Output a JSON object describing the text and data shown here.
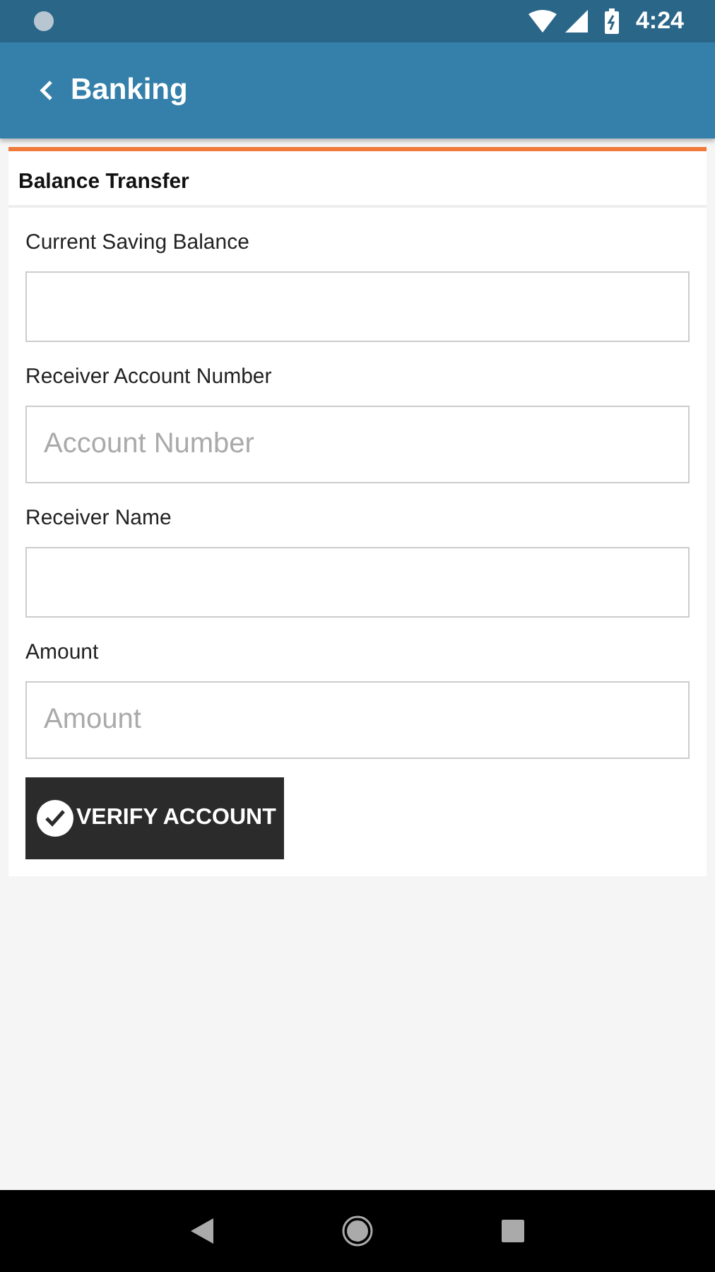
{
  "status_bar": {
    "time": "4:24"
  },
  "app_bar": {
    "title": "Banking"
  },
  "card": {
    "title": "Balance Transfer",
    "fields": [
      {
        "label": "Current Saving Balance"
      },
      {
        "label": "Receiver Account Number",
        "placeholder": "Account Number"
      },
      {
        "label": "Receiver Name"
      },
      {
        "label": "Amount",
        "placeholder": "Amount"
      }
    ],
    "button": "VERIFY ACCOUNT"
  }
}
